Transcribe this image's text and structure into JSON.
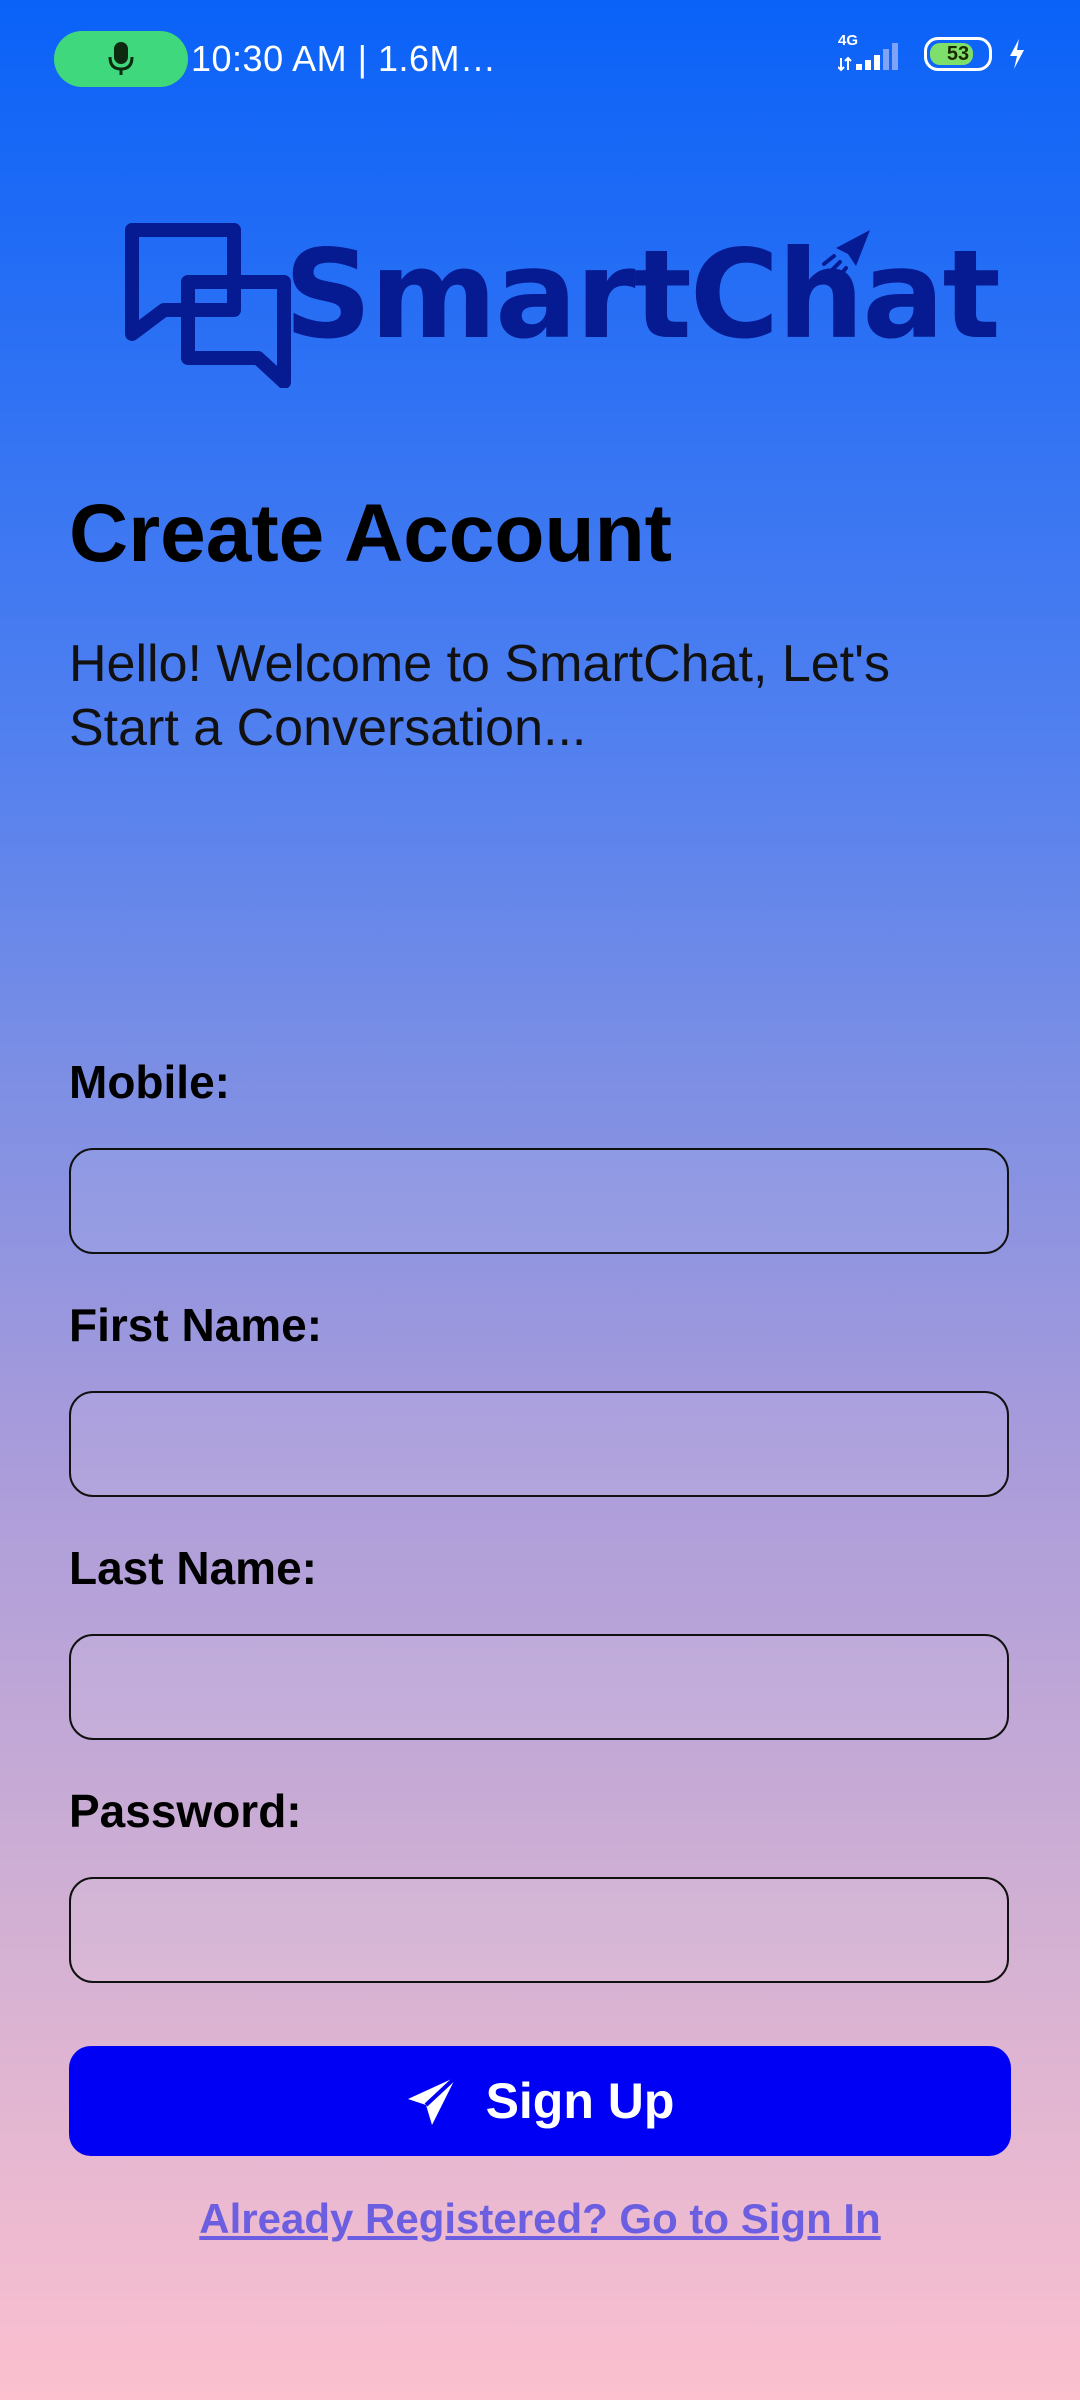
{
  "status_bar": {
    "text": "10:30 AM | 1.6M…",
    "network": "4G",
    "battery": "53"
  },
  "logo": {
    "text": "SmartChat"
  },
  "header": {
    "title": "Create Account",
    "subtitle": "Hello! Welcome to SmartChat, Let's Start a Conversation..."
  },
  "form": {
    "mobile_label": "Mobile:",
    "mobile_value": "",
    "first_name_label": "First Name:",
    "first_name_value": "",
    "last_name_label": "Last Name:",
    "last_name_value": "",
    "password_label": "Password:",
    "password_value": ""
  },
  "actions": {
    "signup_label": "Sign Up",
    "signin_link": "Already Registered? Go to Sign In"
  },
  "colors": {
    "primary_button": "#0000f5",
    "logo": "#061a92",
    "link": "#6b5ee0",
    "mic_pill": "#3fd87d"
  }
}
